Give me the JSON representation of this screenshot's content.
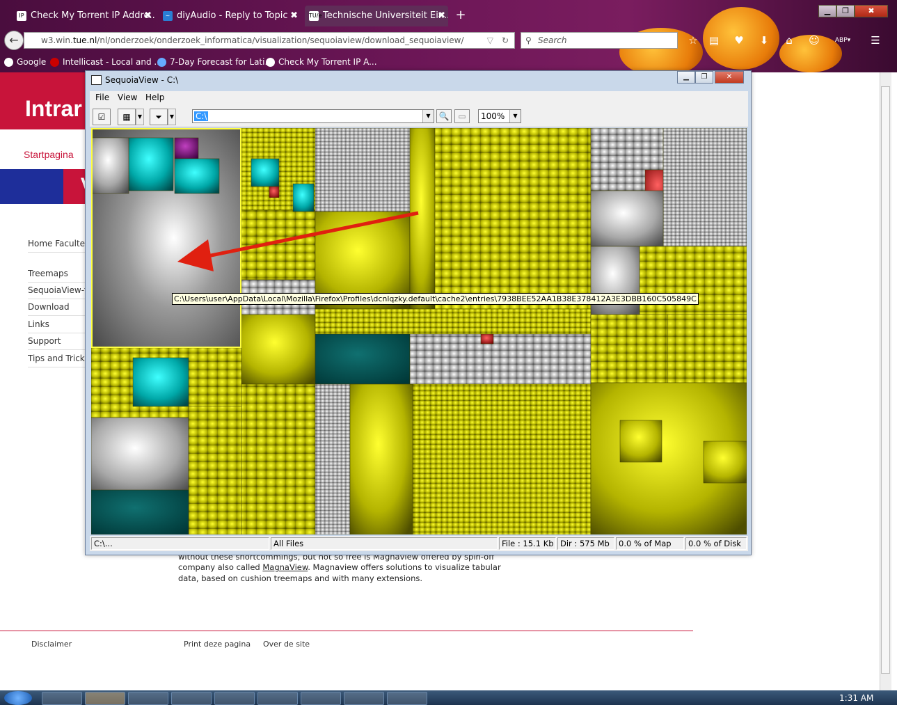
{
  "browser": {
    "tabs": [
      {
        "label": "Check My Torrent IP Addre...",
        "icon": "IP",
        "close": "✖"
      },
      {
        "label": "diyAudio - Reply to Topic",
        "icon": "~",
        "close": "✖"
      },
      {
        "label": "Technische Universiteit Ein...",
        "icon": "TU/e",
        "close": "✖"
      }
    ],
    "new_tab": "+",
    "url_prefix": "w3.win.",
    "url_domain": "tue.nl",
    "url_rest": "/nl/onderzoek/onderzoek_informatica/visualization/sequoiaview/download_sequoiaview/",
    "search_placeholder": "Search",
    "bookmarks": [
      "Google",
      "Intellicast - Local and ...",
      "7-Day Forecast for Lati...",
      "Check My Torrent IP A..."
    ],
    "window_buttons": {
      "minimize": "▁",
      "restore": "❐",
      "close": "✖"
    },
    "toolbar_icons": [
      "star-icon",
      "reading-list-icon",
      "pocket-icon",
      "download-icon",
      "home-icon",
      "emoji-icon",
      "adblock-icon",
      "menu-icon"
    ]
  },
  "page": {
    "site_title": "Intrar",
    "breadcrumb": "Startpagina",
    "blue_band_text": "V",
    "sidebar": [
      "Home Faculteit",
      "Treemaps",
      "SequoiaView-t",
      "Download",
      "Links",
      "Support",
      "Tips and Tricks"
    ],
    "body_lines": [
      "without these shortcommings, but not so free is Magnaview offered by spin-off",
      "company also called",
      "MagnaView",
      ". Magnaview offers solutions to visualize tabular",
      "data, based on cushion treemaps and with many extensions."
    ],
    "footer": [
      "Disclaimer",
      "Print deze pagina",
      "Over de site"
    ]
  },
  "app": {
    "title": "SequoiaView - C:\\",
    "menu": [
      "File",
      "View",
      "Help"
    ],
    "path_value": "C:\\",
    "zoom_value": "100%",
    "tooltip": "C:\\Users\\user\\AppData\\Local\\Mozilla\\Firefox\\Profiles\\dcnlqzky.default\\cache2\\entries\\7938BEE52AA1B38E378412A3E3DBB160C505849C",
    "status": [
      "C:\\...",
      "All Files",
      "File : 15.1 Kb",
      "Dir : 575 Mb",
      "0.0 % of Map",
      "0.0 % of Disk"
    ],
    "colors": {
      "yellow": "#cfcf00",
      "cyan": "#00bcbc",
      "grey": "#c0c0c0",
      "red": "#c00000",
      "green": "#008000",
      "magenta": "#800080",
      "arrow": "#e02010"
    }
  },
  "taskbar": {
    "clock": "1:31 AM"
  }
}
